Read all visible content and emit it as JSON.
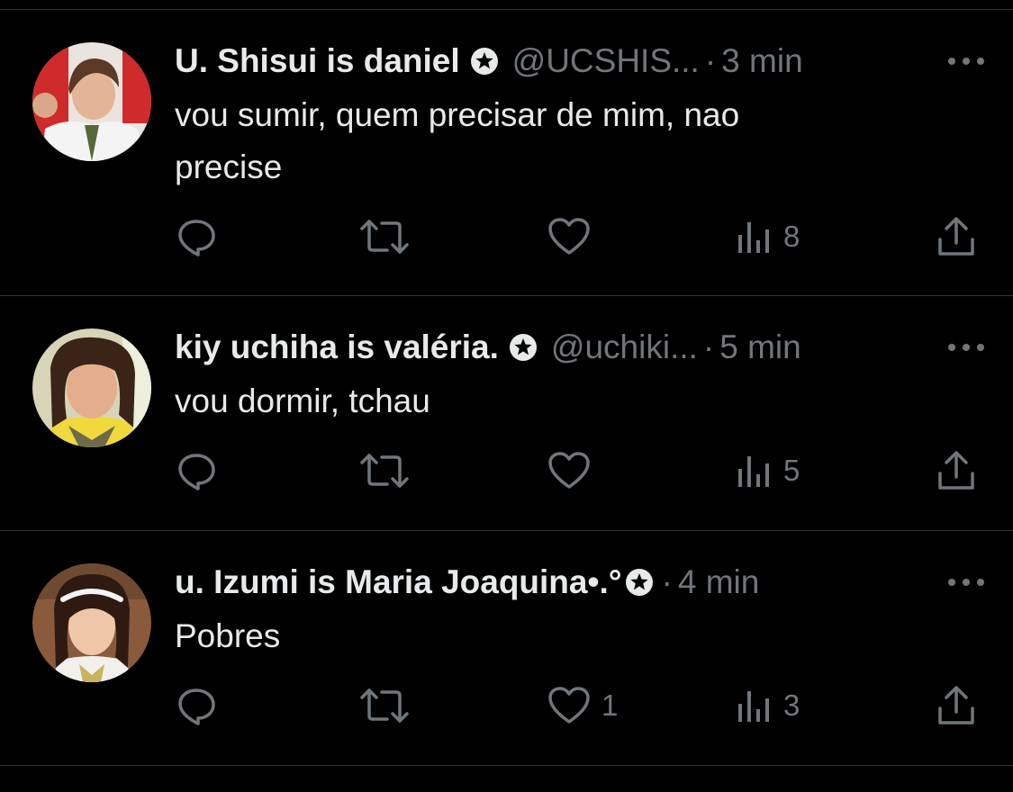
{
  "tweets": [
    {
      "name": "U. Shisui is daniel",
      "handle": "@UCSHIS...",
      "separator": "·",
      "time": "3 min",
      "text_lines": [
        "vou sumir, quem precisar de mim, nao",
        "precise"
      ],
      "views": "8",
      "likes": "",
      "avatar": "boy-in-school-uniform-avatar"
    },
    {
      "name": "kiy uchiha is valéria.",
      "handle": "@uchiki...",
      "separator": "·",
      "time": "5 min",
      "text_lines": [
        "vou dormir, tchau"
      ],
      "views": "5",
      "likes": "",
      "avatar": "girl-in-yellow-uniform-avatar"
    },
    {
      "name": "u. Izumi is Maria Joaquina•.°",
      "handle": "",
      "separator": "·",
      "time": "4 min",
      "text_lines": [
        "Pobres"
      ],
      "views": "3",
      "likes": "1",
      "avatar": "girl-with-headband-avatar"
    }
  ],
  "colors": {
    "background": "#000000",
    "text_primary": "#e7e9ea",
    "text_secondary": "#71767b",
    "divider": "#2f3336"
  },
  "icons": [
    "reply-icon",
    "retweet-icon",
    "like-icon",
    "views-icon",
    "share-icon",
    "more-icon",
    "verified-badge-icon"
  ]
}
